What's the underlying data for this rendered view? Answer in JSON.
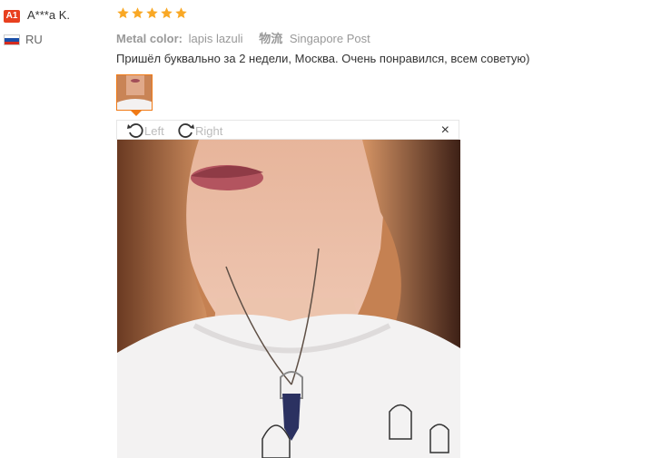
{
  "reviewer": {
    "level_badge": "A1",
    "name": "A***a K.",
    "country": "RU",
    "flag_colors": [
      "#ffffff",
      "#1b4fa8",
      "#d52b1e"
    ]
  },
  "review": {
    "rating": 5,
    "star_color": "#f9a825",
    "attribute_label": "Metal color:",
    "attribute_value": "lapis lazuli",
    "shipping_label": "物流",
    "shipping_value": "Singapore Post",
    "text": "Пришёл буквально за 2 недели, Москва. Очень понравился, всем советую)"
  },
  "viewer": {
    "rotate_left_label": "Left",
    "rotate_right_label": "Right",
    "close_label": "×",
    "accent_color": "#f07a16"
  }
}
